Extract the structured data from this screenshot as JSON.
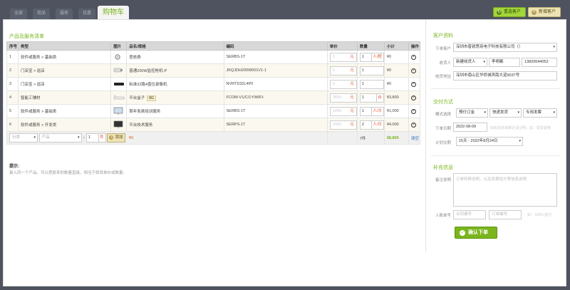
{
  "tabs": [
    {
      "label": "全部"
    },
    {
      "label": "商品"
    },
    {
      "label": "服务"
    },
    {
      "label": "优惠"
    },
    {
      "label": "购物车"
    }
  ],
  "top_buttons": {
    "select_customer": "重选客户",
    "add_customer": "新增客户"
  },
  "products": {
    "title": "产品及服务清单",
    "columns": [
      "序号",
      "类型",
      "图片",
      "品名/规格",
      "编码",
      "单价",
      "数量",
      "小计",
      "操作"
    ],
    "rows": [
      {
        "no": "1",
        "type": "软件或服务 > 基础类",
        "image": "gear-icon",
        "name": "差旅费",
        "tag": "",
        "code": "SERBS-1T",
        "price": "0",
        "price_unit": "元",
        "qty": "1",
        "qty_unit": "人/程",
        "subtotal": "¥0"
      },
      {
        "no": "2",
        "type": "门店宝 > 巡店",
        "image": "camera-icon",
        "name": "普通200W监控枪机-P",
        "tag": "",
        "code": "JKQJDH200W001V1-1",
        "price": "0",
        "price_unit": "元",
        "qty": "1",
        "qty_unit": "",
        "subtotal": "¥0"
      },
      {
        "no": "3",
        "type": "门店宝 > 巡店",
        "image": "recorder-icon",
        "name": "标准32路4盘位录像机",
        "tag": "",
        "code": "NVRTD32L4P0",
        "price": "0",
        "price_unit": "元",
        "qty": "1",
        "qty_unit": "",
        "subtotal": "¥0"
      },
      {
        "no": "4",
        "type": "智能工辅材",
        "image": "router-icon",
        "name": "平台盒子",
        "tag": "8G",
        "code": "FCOM-V1/C/1Y/WIFI-",
        "price": "3800",
        "price_unit": "元",
        "qty": "1",
        "qty_unit": "台",
        "subtotal": "¥3,800"
      },
      {
        "no": "5",
        "type": "软件或服务 > 基础类",
        "image": "monitor-icon",
        "name": "首年免费培训服务",
        "tag": "",
        "code": "SERBS-1T",
        "price": "1000",
        "price_unit": "元",
        "qty": "1",
        "qty_unit": "人/次",
        "subtotal": "¥1,000"
      },
      {
        "no": "6",
        "type": "软件或服务 > 开发类",
        "image": "monitor-icon",
        "name": "平台技术服务",
        "tag": "",
        "code": "SERPS-1T",
        "price": "2000",
        "price_unit": "元",
        "qty": "2",
        "qty_unit": "人/日",
        "subtotal": "¥4,000"
      }
    ],
    "add_row": {
      "category_placeholder": "分类",
      "product_placeholder": "产品",
      "times": "×",
      "qty": "1",
      "qty_unit": "件",
      "add_label": "添加",
      "amount": "¥0",
      "total_count": "7件",
      "total_amount": "¥8,800",
      "clear_label": "清空"
    },
    "hint_title": "提示:",
    "hint_text": "录入同一个产品，可以把原来的数量直接，相当于修改单价或数量;"
  },
  "customer": {
    "title": "客户资料",
    "order_customer_label": "下单客户",
    "order_customer_value": "深圳市普锐思亮电子科技有限公司（）",
    "receiver_label": "收货人",
    "receiver_type": "新建收货人",
    "receiver_name": "李明都",
    "receiver_phone": "13820644052",
    "address_label": "收货地址",
    "address_value": "深圳市南山区华侨城滨南大道9037号"
  },
  "delivery": {
    "title": "交付方式",
    "mode_label": "模式选择",
    "mode_values": [
      "预付订金",
      "快递发货",
      "专用发票"
    ],
    "order_date_label": "下单日期",
    "order_date_value": "2022-08-09",
    "order_date_note": "如有改变或推迟请注明，如：需安装等",
    "plan_label": "计划交期",
    "plan_value": "15天 - 2022年8月24日"
  },
  "extra": {
    "title": "补充信息",
    "remark_label": "备注说明",
    "remark_placeholder": "订单特殊说明，以及发票抬头等信息说明",
    "voucher_label": "入账单号",
    "contract_placeholder": "合同编号",
    "order_no_placeholder": "订单编号",
    "voucher_note": "如：100%,首付",
    "confirm_label": "确认下单"
  }
}
